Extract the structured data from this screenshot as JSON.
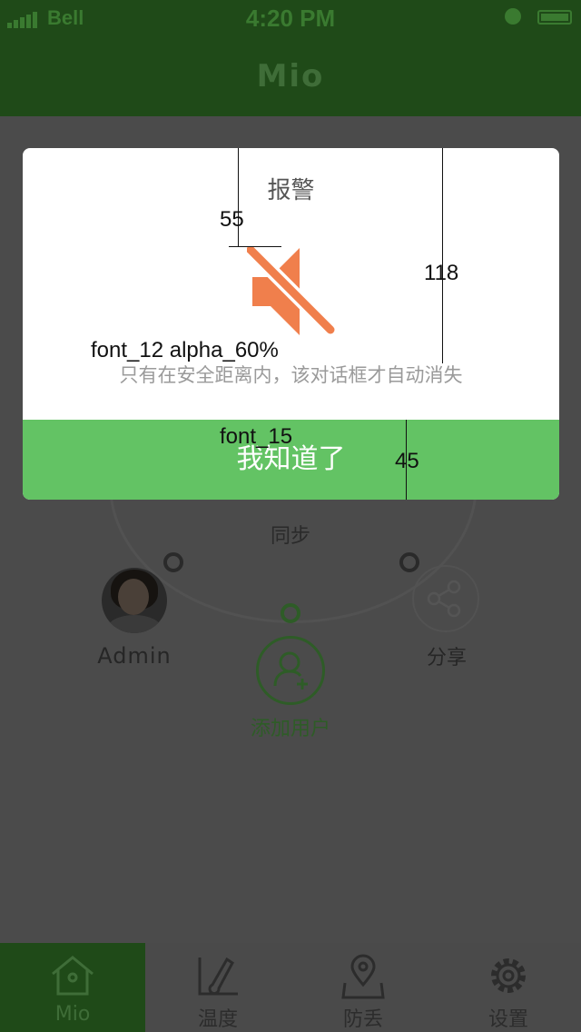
{
  "status_bar": {
    "carrier": "Bell",
    "time": "4:20 PM"
  },
  "nav": {
    "title": "Mio"
  },
  "home": {
    "sync_label": "同步",
    "user_name": "Admin",
    "share_label": "分享",
    "add_user_label": "添加用户"
  },
  "tabs": [
    {
      "label": "Mio",
      "icon": "house-icon",
      "active": true
    },
    {
      "label": "温度",
      "icon": "thermometer-icon",
      "active": false
    },
    {
      "label": "防丢",
      "icon": "location-pin-icon",
      "active": false
    },
    {
      "label": "设置",
      "icon": "gear-icon",
      "active": false
    }
  ],
  "dialog": {
    "title": "报警",
    "icon": "mute-speaker-icon",
    "message": "只有在安全距离内，该对话框才自动消失",
    "button_label": "我知道了",
    "colors": {
      "button": "#63c364",
      "icon": "#f07f4c"
    }
  },
  "annotations": {
    "title_gap": "55",
    "content_height": "118",
    "message_font": "font_12  alpha_60%",
    "button_font": "font_15",
    "button_height": "45"
  },
  "colors": {
    "nav_bg": "#1f4a18",
    "overlay_bg": "#4b4b4b"
  }
}
